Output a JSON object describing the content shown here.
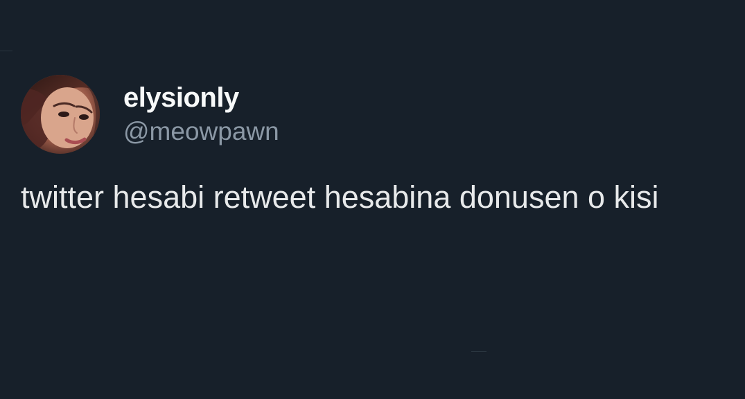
{
  "tweet": {
    "display_name": "elysionly",
    "handle": "@meowpawn",
    "text": "twitter hesabi retweet hesabina donusen o kisi",
    "avatar_icon": "profile-photo"
  },
  "colors": {
    "background": "#17202a",
    "text": "#e7e9ea",
    "secondary_text": "#8b98a5"
  }
}
